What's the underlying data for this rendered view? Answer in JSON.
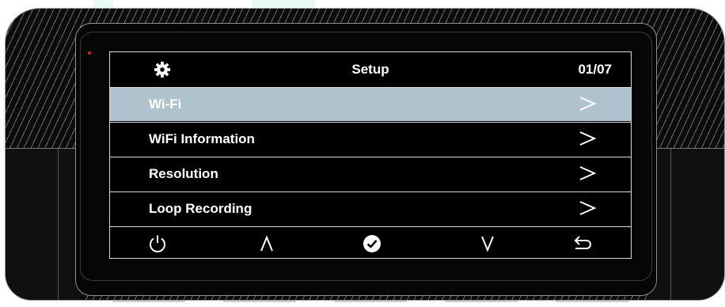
{
  "screen": {
    "title": "Setup",
    "page_counter": "01/07",
    "menu_items": [
      {
        "label": "Wi-Fi",
        "selected": true,
        "chevron": ">"
      },
      {
        "label": "WiFi Information",
        "selected": false,
        "chevron": ">"
      },
      {
        "label": "Resolution",
        "selected": false,
        "chevron": ">"
      },
      {
        "label": "Loop Recording",
        "selected": false,
        "chevron": ">"
      }
    ],
    "controls": [
      "power-icon",
      "up-caret-icon",
      "confirm-check-icon",
      "down-caret-icon",
      "back-return-icon"
    ]
  },
  "colors": {
    "selected_row": "#aec3ce",
    "screen_background": "#000000",
    "text": "#ffffff",
    "status_led": "#e32020"
  }
}
